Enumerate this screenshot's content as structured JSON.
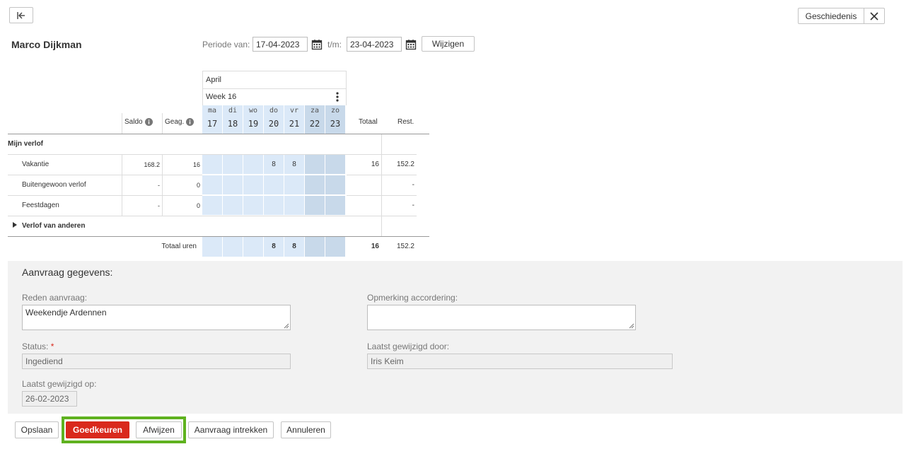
{
  "toolbar": {
    "collapse_icon": "collapse-left-icon",
    "history_label": "Geschiedenis",
    "close_icon": "close-icon"
  },
  "employee": {
    "name": "Marco Dijkman"
  },
  "period": {
    "from_label": "Periode van:",
    "from_value": "17-04-2023",
    "to_label": "t/m:",
    "to_value": "23-04-2023",
    "change_label": "Wijzigen",
    "calendar_icon": "calendar-icon"
  },
  "grid": {
    "month": "April",
    "week": "Week 16",
    "menu_icon": "kebab-menu-icon",
    "info_icon": "info-icon",
    "headers": {
      "saldo": "Saldo",
      "geag": "Geag.",
      "totaal": "Totaal",
      "rest": "Rest."
    },
    "days": [
      {
        "dow": "ma",
        "num": "17",
        "weekend": false
      },
      {
        "dow": "di",
        "num": "18",
        "weekend": false
      },
      {
        "dow": "wo",
        "num": "19",
        "weekend": false
      },
      {
        "dow": "do",
        "num": "20",
        "weekend": false
      },
      {
        "dow": "vr",
        "num": "21",
        "weekend": false
      },
      {
        "dow": "za",
        "num": "22",
        "weekend": true
      },
      {
        "dow": "zo",
        "num": "23",
        "weekend": true
      }
    ],
    "section_mine": "Mijn verlof",
    "rows": [
      {
        "label": "Vakantie",
        "saldo": "168.2",
        "geag": "16",
        "d": [
          "",
          "",
          "",
          "8",
          "8",
          "",
          ""
        ],
        "totaal": "16",
        "rest": "152.2"
      },
      {
        "label": "Buitengewoon verlof",
        "saldo": "-",
        "geag": "0",
        "d": [
          "",
          "",
          "",
          "",
          "",
          "",
          ""
        ],
        "totaal": "",
        "rest": "-"
      },
      {
        "label": "Feestdagen",
        "saldo": "-",
        "geag": "0",
        "d": [
          "",
          "",
          "",
          "",
          "",
          "",
          ""
        ],
        "totaal": "",
        "rest": "-"
      }
    ],
    "section_others": "Verlof van anderen",
    "expand_icon": "triangle-right-icon",
    "total_row": {
      "label": "Totaal uren",
      "d": [
        "",
        "",
        "",
        "8",
        "8",
        "",
        ""
      ],
      "totaal": "16",
      "rest": "152.2"
    }
  },
  "request": {
    "heading": "Aanvraag gegevens:",
    "reason_label": "Reden aanvraag:",
    "reason_value": "Weekendje Ardennen",
    "remark_label": "Opmerking accordering:",
    "remark_value": "",
    "status_label": "Status:",
    "required_mark": "*",
    "status_value": "Ingediend",
    "changed_by_label": "Laatst gewijzigd door:",
    "changed_by_value": "Iris Keim",
    "changed_on_label": "Laatst gewijzigd op:",
    "changed_on_value": "26-02-2023"
  },
  "actions": {
    "save": "Opslaan",
    "approve": "Goedkeuren",
    "reject": "Afwijzen",
    "withdraw": "Aanvraag intrekken",
    "cancel": "Annuleren"
  },
  "colors": {
    "approve_bg": "#d9291c",
    "highlight": "#5fb21f",
    "weekday": "#dbe9f8",
    "weekend": "#c8d9ea",
    "panel_bg": "#f2f2f2"
  }
}
